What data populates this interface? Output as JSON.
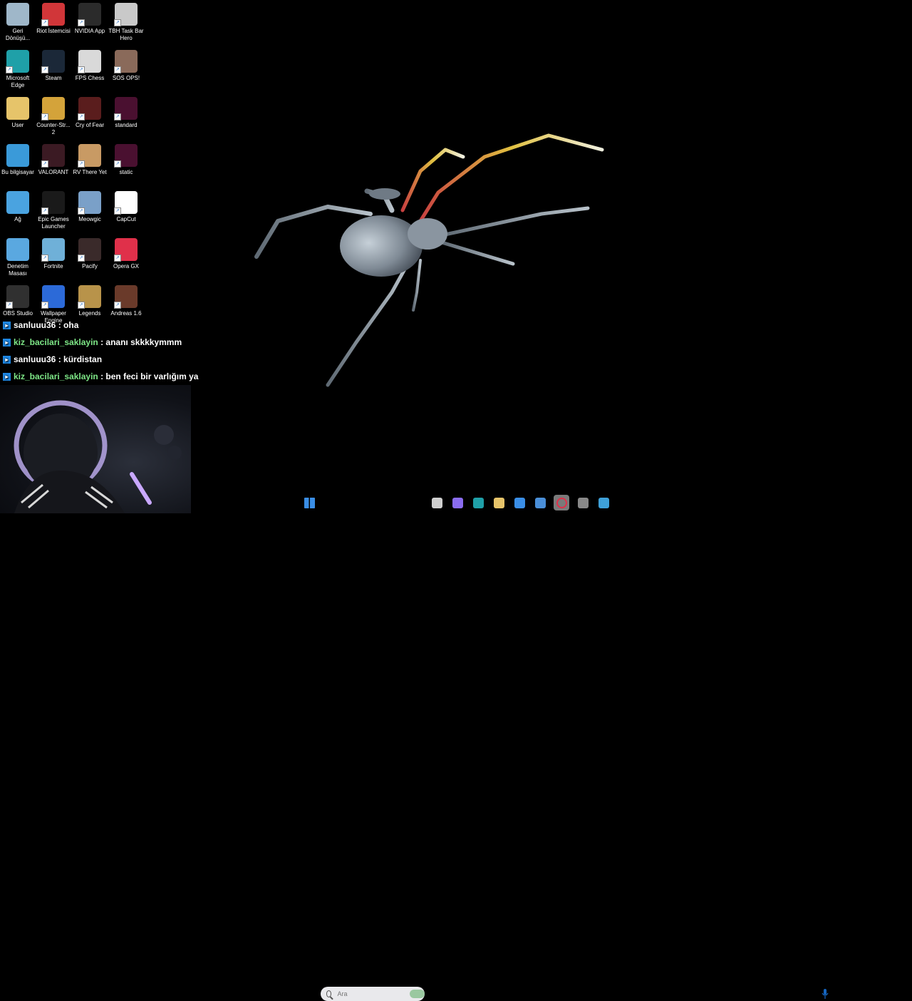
{
  "desktop_icons": [
    {
      "label": "Geri Dönüşü...",
      "icon": "recycle-bin-icon",
      "color": "#9fb7c9"
    },
    {
      "label": "Riot İstemcisi",
      "icon": "riot-client-icon",
      "color": "#d13639"
    },
    {
      "label": "NVIDIA App",
      "icon": "nvidia-icon",
      "color": "#2b2b2b"
    },
    {
      "label": "TBH Task Bar Hero",
      "icon": "tbh-icon",
      "color": "#c9c9c9"
    },
    {
      "label": "Microsoft Edge",
      "icon": "edge-icon",
      "color": "#1fa0a8"
    },
    {
      "label": "Steam",
      "icon": "steam-icon",
      "color": "#1b2838"
    },
    {
      "label": "FPS Chess",
      "icon": "fps-chess-icon",
      "color": "#d9d9d9"
    },
    {
      "label": "SOS OPS!",
      "icon": "sos-ops-icon",
      "color": "#8a6a5a"
    },
    {
      "label": "User",
      "icon": "folder-icon",
      "color": "#e6c46a"
    },
    {
      "label": "Counter-Str... 2",
      "icon": "counter-strike-icon",
      "color": "#d4a33a"
    },
    {
      "label": "Cry of Fear",
      "icon": "cry-of-fear-icon",
      "color": "#5a1d1d"
    },
    {
      "label": "standard",
      "icon": "wallpaper-file-icon",
      "color": "#4a1030"
    },
    {
      "label": "Bu bilgisayar",
      "icon": "computer-icon",
      "color": "#3a9ad9"
    },
    {
      "label": "VALORANT",
      "icon": "valorant-icon",
      "color": "#3b1a23"
    },
    {
      "label": "RV There Yet",
      "icon": "rv-there-yet-icon",
      "color": "#c89a64"
    },
    {
      "label": "static",
      "icon": "wallpaper-file-icon",
      "color": "#4a1030"
    },
    {
      "label": "Ağ",
      "icon": "network-icon",
      "color": "#4aa3e0"
    },
    {
      "label": "Epic Games Launcher",
      "icon": "epic-games-icon",
      "color": "#1a1a1a"
    },
    {
      "label": "Meowgic",
      "icon": "meowgic-icon",
      "color": "#7aa0c8"
    },
    {
      "label": "CapCut",
      "icon": "capcut-icon",
      "color": "#ffffff"
    },
    {
      "label": "Denetim Masası",
      "icon": "control-panel-icon",
      "color": "#5aa8e0"
    },
    {
      "label": "Fortnite",
      "icon": "fortnite-icon",
      "color": "#6fb0d8"
    },
    {
      "label": "Pacify",
      "icon": "pacify-icon",
      "color": "#3a2a2a"
    },
    {
      "label": "Opera GX",
      "icon": "opera-gx-icon",
      "color": "#e0304a"
    },
    {
      "label": "OBS Studio",
      "icon": "obs-icon",
      "color": "#303030"
    },
    {
      "label": "Wallpaper Engine",
      "icon": "wallpaper-engine-icon",
      "color": "#2c6ad8"
    },
    {
      "label": "Legends",
      "icon": "league-of-legends-icon",
      "color": "#b8934a"
    },
    {
      "label": "Andreas 1.6",
      "icon": "game-icon",
      "color": "#6a3a2a"
    }
  ],
  "chat": [
    {
      "user": "sanluuu36",
      "color": "#ffffff",
      "sep": " : ",
      "message": "oha"
    },
    {
      "user": "kiz_bacilari_saklayin",
      "color": "#7ee787",
      "sep": " : ",
      "message": "ananı skkkkymmm"
    },
    {
      "user": "sanluuu36",
      "color": "#ffffff",
      "sep": " : ",
      "message": "kürdistan"
    },
    {
      "user": "kiz_bacilari_saklayin",
      "color": "#7ee787",
      "sep": " : ",
      "message": "ben feci bir varlığım ya"
    }
  ],
  "taskbar": {
    "search_placeholder": "Ara",
    "items": [
      {
        "name": "start-button",
        "icon": "windows-logo-icon",
        "color": "#3a8ee6"
      },
      {
        "name": "task-view-button",
        "icon": "task-view-icon",
        "color": "#cfcfcf"
      },
      {
        "name": "copilot-button",
        "icon": "copilot-icon",
        "color": "#8a6cf0"
      },
      {
        "name": "edge-taskbar-button",
        "icon": "edge-icon",
        "color": "#1fa0a8"
      },
      {
        "name": "file-explorer-button",
        "icon": "folder-icon",
        "color": "#e6c46a"
      },
      {
        "name": "store-button",
        "icon": "store-icon",
        "color": "#3a8ee6"
      },
      {
        "name": "mail-button",
        "icon": "mail-icon",
        "color": "#4a8fd8"
      },
      {
        "name": "opera-taskbar-button",
        "icon": "opera-gx-icon",
        "color": "#e0304a"
      },
      {
        "name": "app-taskbar-button",
        "icon": "app-icon",
        "color": "#888888"
      },
      {
        "name": "photos-button",
        "icon": "photos-icon",
        "color": "#3ea0d8"
      }
    ]
  }
}
